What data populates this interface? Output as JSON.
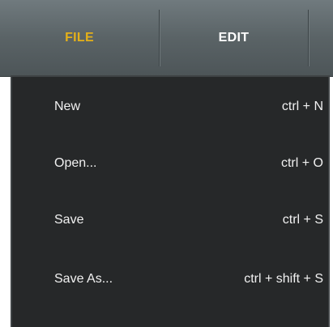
{
  "menubar": {
    "tabs": [
      {
        "label": "FILE",
        "active": true
      },
      {
        "label": "EDIT",
        "active": false
      }
    ],
    "active_color": "#e4b019"
  },
  "file_menu": {
    "items": [
      {
        "label": "New",
        "shortcut": "ctrl + N"
      },
      {
        "label": "Open...",
        "shortcut": "ctrl + O"
      },
      {
        "label": "Save",
        "shortcut": "ctrl + S"
      },
      {
        "label": "Save As...",
        "shortcut": "ctrl + shift + S"
      }
    ]
  }
}
